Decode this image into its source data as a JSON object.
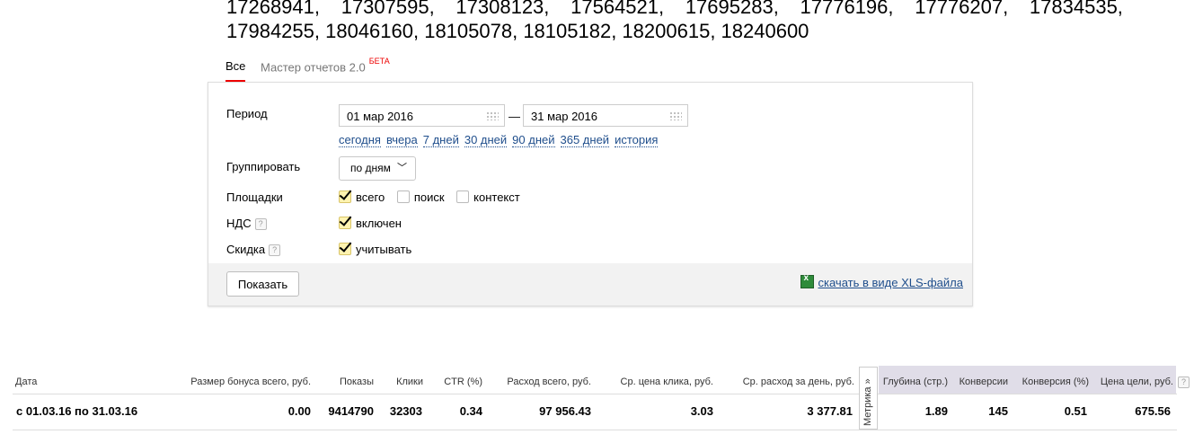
{
  "campaign_ids": {
    "line1": [
      "17268941,",
      "17307595,",
      "17308123,",
      "17564521,",
      "17695283,",
      "17776196,",
      "17776207,",
      "17834535,"
    ],
    "line2": "17984255, 18046160, 18105078, 18105182, 18200615, 18240600"
  },
  "tabs": {
    "all": "Все",
    "master": "Мастер отчетов 2.0",
    "master_badge": "БЕТА"
  },
  "form": {
    "period_label": "Период",
    "date_from": "01 мар 2016",
    "date_sep": "—",
    "date_to": "31 мар 2016",
    "quick": [
      "сегодня",
      "вчера",
      "7 дней",
      "30 дней",
      "90 дней",
      "365 дней",
      "история"
    ],
    "group_label": "Группировать",
    "group_value": "по дням",
    "sites_label": "Площадки",
    "sites": {
      "all": "всего",
      "search": "поиск",
      "context": "контекст"
    },
    "vat_label": "НДС",
    "vat_value": "включен",
    "discount_label": "Скидка",
    "discount_value": "учитывать",
    "help": "?",
    "show_button": "Показать",
    "xls_link": "скачать в виде XLS-файла"
  },
  "metrika_tab": "Метрика »",
  "table": {
    "headers": {
      "date": "Дата",
      "bonus": "Размер бонуса всего, руб.",
      "shows": "Показы",
      "clicks": "Клики",
      "ctr": "CTR (%)",
      "spend": "Расход всего, руб.",
      "cpc": "Ср. цена клика, руб.",
      "daily": "Ср. расход за день, руб.",
      "depth": "Глубина (стр.)",
      "conv": "Конверсии",
      "conv_rate": "Конверсия (%)",
      "goal_price": "Цена цели, руб."
    },
    "row": {
      "date": "с 01.03.16 по 31.03.16",
      "bonus": "0.00",
      "shows": "9414790",
      "clicks": "32303",
      "ctr": "0.34",
      "spend": "97 956.43",
      "cpc": "3.03",
      "daily": "3 377.81",
      "depth": "1.89",
      "conv": "145",
      "conv_rate": "0.51",
      "goal_price": "675.56"
    }
  }
}
